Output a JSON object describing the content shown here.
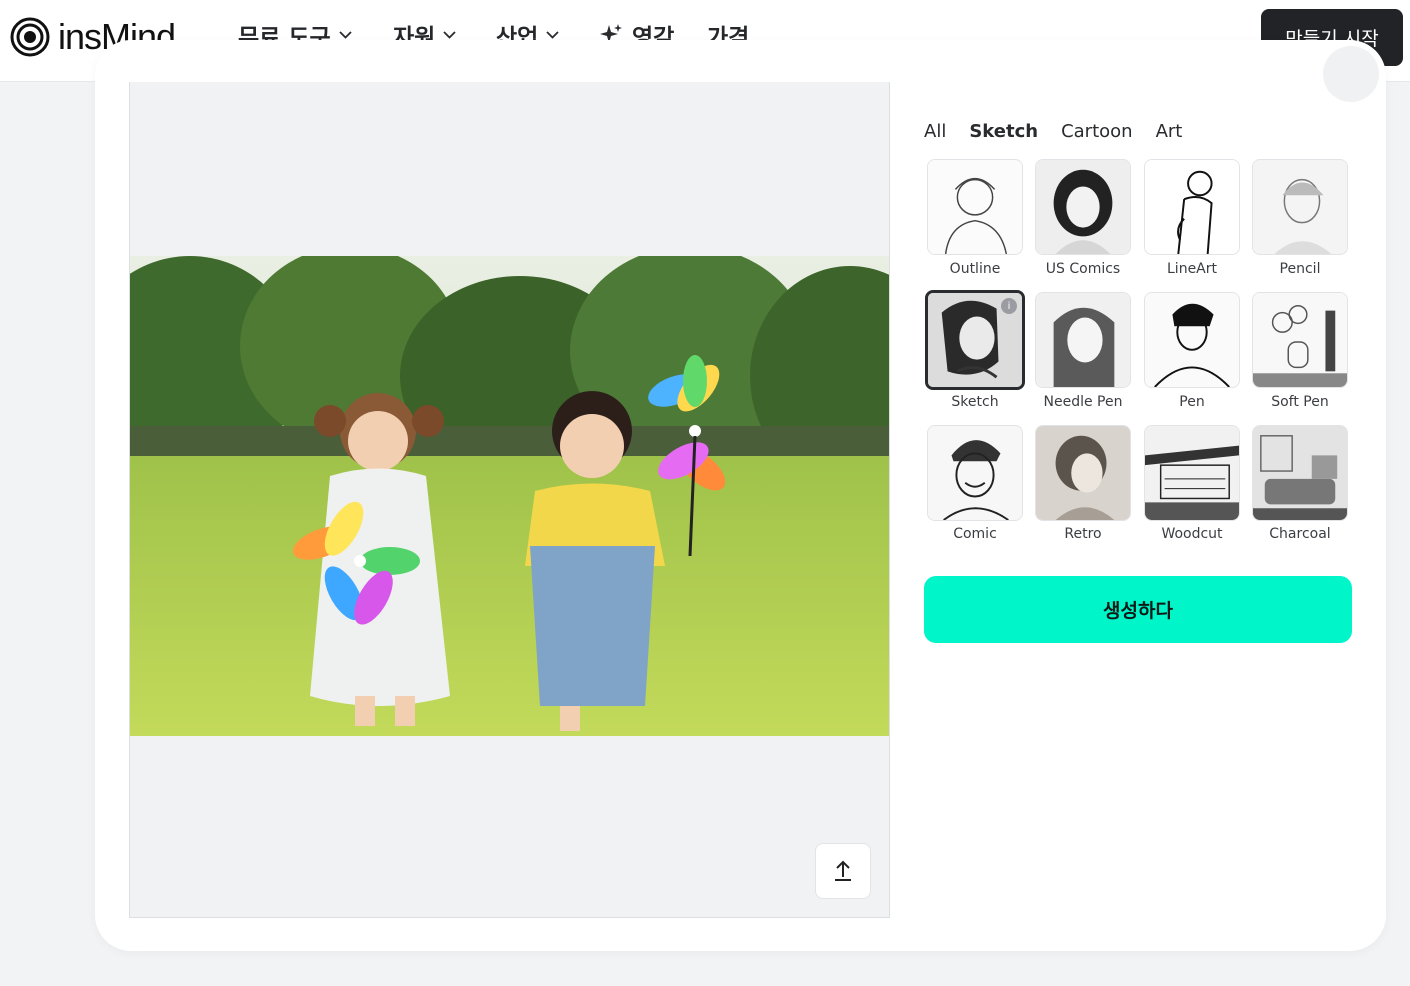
{
  "brand": {
    "name": "insMind"
  },
  "nav": {
    "items": [
      {
        "label": "무료 도구",
        "icon": "chevron-down-icon"
      },
      {
        "label": "자원",
        "icon": "chevron-down-icon"
      },
      {
        "label": "산업",
        "icon": "chevron-down-icon"
      },
      {
        "label": "영감",
        "icon": "sparkle-icon"
      },
      {
        "label": "가격"
      }
    ],
    "cta_label": "만들기 시작"
  },
  "editor": {
    "photo_description_icon": "image-preview",
    "upload_icon": "upload-arrow-icon"
  },
  "styles": {
    "tabs": [
      {
        "label": "All",
        "active": false
      },
      {
        "label": "Sketch",
        "active": true
      },
      {
        "label": "Cartoon",
        "active": false
      },
      {
        "label": "Art",
        "active": false
      }
    ],
    "items": [
      {
        "label": "Outline",
        "selected": false
      },
      {
        "label": "US Comics",
        "selected": false
      },
      {
        "label": "LineArt",
        "selected": false
      },
      {
        "label": "Pencil",
        "selected": false
      },
      {
        "label": "Sketch",
        "selected": true
      },
      {
        "label": "Needle Pen",
        "selected": false
      },
      {
        "label": "Pen",
        "selected": false
      },
      {
        "label": "Soft Pen",
        "selected": false
      },
      {
        "label": "Comic",
        "selected": false
      },
      {
        "label": "Retro",
        "selected": false
      },
      {
        "label": "Woodcut",
        "selected": false
      },
      {
        "label": "Charcoal",
        "selected": false
      }
    ],
    "selected_badge": "i"
  },
  "generate_label": "생성하다",
  "colors": {
    "accent": "#00f5c8",
    "cta_bg": "#212327"
  }
}
